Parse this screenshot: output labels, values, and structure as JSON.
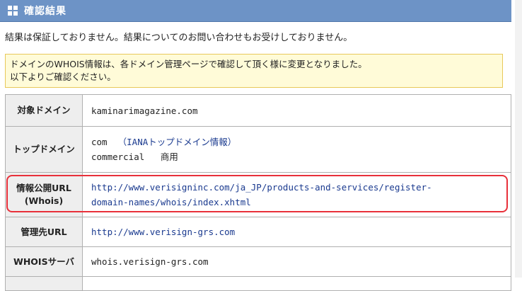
{
  "header": {
    "title": "確認結果",
    "icon": "grid-icon"
  },
  "notice": "結果は保証しておりません。結果についてのお問い合わせもお受けしておりません。",
  "alert": {
    "line1": "ドメインのWHOIS情報は、各ドメイン管理ページで確認して頂く様に変更となりました。",
    "line2": "以下よりご確認ください。"
  },
  "rows": {
    "domain": {
      "label": "対象ドメイン",
      "value": "kaminarimagazine.com"
    },
    "tld": {
      "label": "トップドメイン",
      "code": "com",
      "iana_link": "（IANAトップドメイン情報）",
      "type": "commercial",
      "type_jp": "商用"
    },
    "whois_url": {
      "label_line1": "情報公開URL",
      "label_line2": "(Whois)",
      "url_line1": "http://www.verisigninc.com/ja_JP/products-and-services/register-",
      "url_line2": "domain-names/whois/index.xhtml"
    },
    "registrar_url": {
      "label": "管理先URL",
      "value": "http://www.verisign-grs.com"
    },
    "whois_server": {
      "label": "WHOISサーバ",
      "value": "whois.verisign-grs.com"
    }
  },
  "colors": {
    "header_bg": "#6d93c6",
    "alert_bg": "#fffbd8",
    "highlight": "#e8303a",
    "link": "#1a3a8f"
  }
}
